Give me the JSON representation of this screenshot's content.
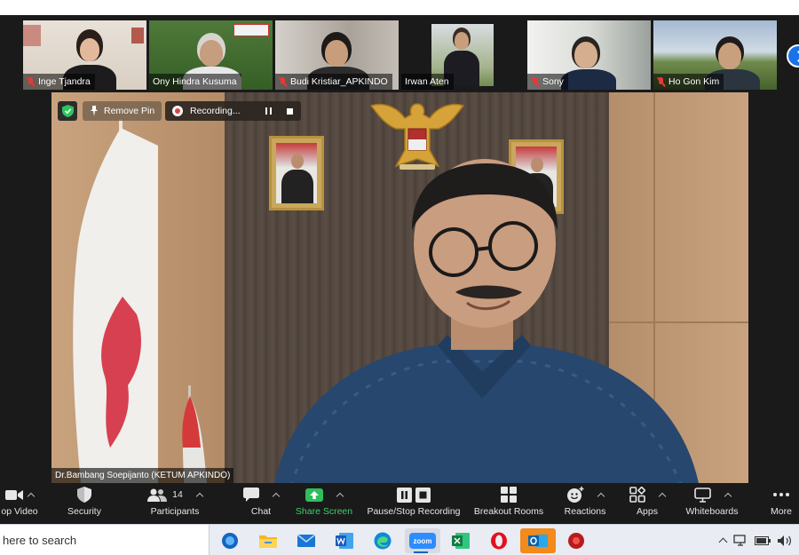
{
  "participants": [
    {
      "name": "Inge Tjandra",
      "muted": true
    },
    {
      "name": "Ony Hindra Kusuma",
      "muted": false
    },
    {
      "name": "Budi Kristiar_APKINDO",
      "muted": true
    },
    {
      "name": "Irwan Aten",
      "muted": false
    },
    {
      "name": "Sony",
      "muted": true
    },
    {
      "name": "Ho Gon Kim",
      "muted": true
    }
  ],
  "main_video": {
    "speaker_name": "Dr.Bambang Soepijanto (KETUM APKINDO)",
    "remove_pin_label": "Remove Pin",
    "recording_label": "Recording..."
  },
  "toolbar": {
    "stop_video": "op Video",
    "security": "Security",
    "participants": "Participants",
    "participants_count": "14",
    "chat": "Chat",
    "share_screen": "Share Screen",
    "pause_stop_recording": "Pause/Stop Recording",
    "breakout_rooms": "Breakout Rooms",
    "reactions": "Reactions",
    "apps": "Apps",
    "whiteboards": "Whiteboards",
    "more": "More"
  },
  "taskbar": {
    "search_placeholder": "here to search",
    "zoom_label": "zoom",
    "apps": [
      "search-icon",
      "file-explorer-icon",
      "mail-icon",
      "word-icon",
      "edge-icon",
      "zoom-icon",
      "excel-icon",
      "opera-icon",
      "outlook-icon",
      "game-icon"
    ]
  },
  "colors": {
    "accent_blue": "#1a73e8",
    "share_green": "#3cd26a",
    "muted_red": "#e53935"
  }
}
